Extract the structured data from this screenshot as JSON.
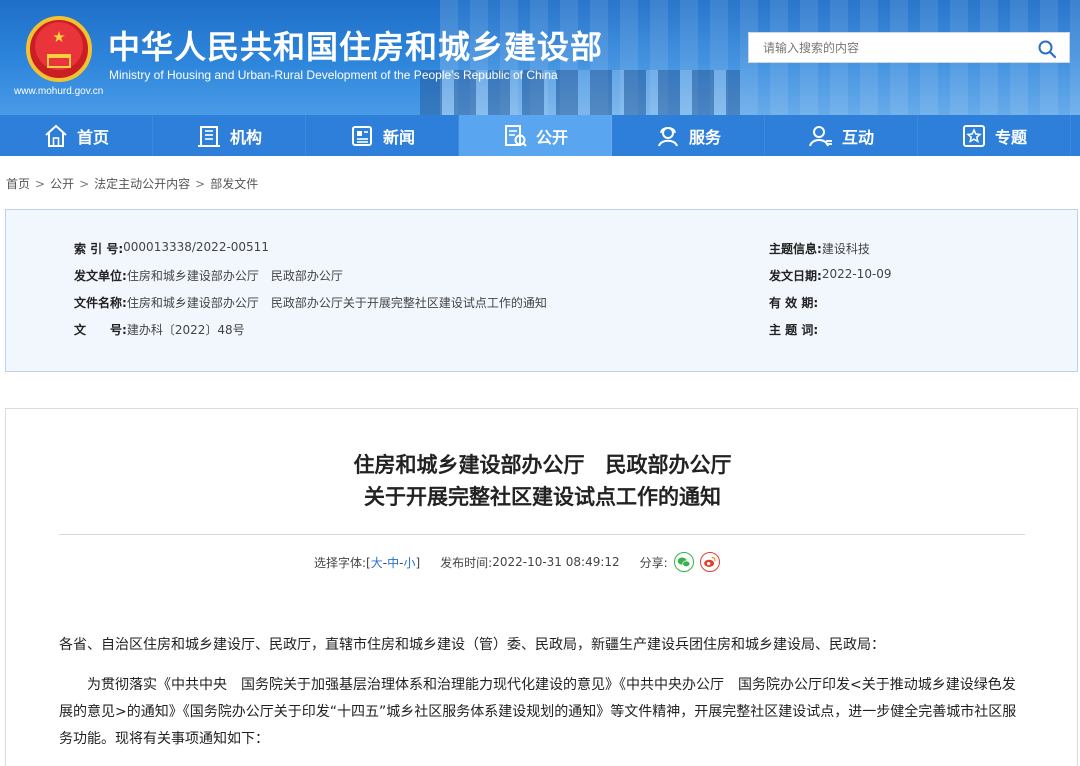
{
  "header": {
    "title_cn": "中华人民共和国住房和城乡建设部",
    "title_en": "Ministry of Housing and Urban-Rural Development of the People’s Republic of China",
    "site_url": "www.mohurd.gov.cn",
    "search_placeholder": "请输入搜索的内容",
    "search_icon": "search-icon"
  },
  "nav": {
    "items": [
      {
        "label": "首页",
        "icon": "home-icon"
      },
      {
        "label": "机构",
        "icon": "building-icon"
      },
      {
        "label": "新闻",
        "icon": "newspaper-icon"
      },
      {
        "label": "公开",
        "icon": "document-icon"
      },
      {
        "label": "服务",
        "icon": "service-icon"
      },
      {
        "label": "互动",
        "icon": "user-icon"
      },
      {
        "label": "专题",
        "icon": "star-icon"
      }
    ],
    "active_index": 3
  },
  "breadcrumb": [
    "首页",
    "公开",
    "法定主动公开内容",
    "部发文件"
  ],
  "info": {
    "index_label": "索 引 号:",
    "index_value": "000013338/2022-00511",
    "unit_label": "发文单位:",
    "unit_value": "住房和城乡建设部办公厅　民政部办公厅",
    "docname_label": "文件名称:",
    "docname_value": "住房和城乡建设部办公厅　民政部办公厅关于开展完整社区建设试点工作的通知",
    "docno_label": "文　　号:",
    "docno_value": "建办科〔2022〕48号",
    "subject_label": "主题信息:",
    "subject_value": "建设科技",
    "date_label": "发文日期:",
    "date_value": "2022-10-09",
    "validity_label": "有 效 期:",
    "validity_value": "",
    "keywords_label": "主 题 词:",
    "keywords_value": ""
  },
  "article": {
    "title_line1": "住房和城乡建设部办公厅　民政部办公厅",
    "title_line2": "关于开展完整社区建设试点工作的通知",
    "font_label": "选择字体:[",
    "font_large": "大",
    "font_medium": "中",
    "font_small": "小",
    "font_close": "]",
    "publish_label": "发布时间:",
    "publish_time": "2022-10-31 08:49:12",
    "share_label": "分享:",
    "para1": "各省、自治区住房和城乡建设厅、民政厅，直辖市住房和城乡建设（管）委、民政局，新疆生产建设兵团住房和城乡建设局、民政局：",
    "para2": "为贯彻落实《中共中央　国务院关于加强基层治理体系和治理能力现代化建设的意见》《中共中央办公厅　国务院办公厅印发<关于推动城乡建设绿色发展的意见>的通知》《国务院办公厅关于印发“十四五”城乡社区服务体系建设规划的通知》等文件精神，开展完整社区建设试点，进一步健全完善城市社区服务功能。现将有关事项通知如下："
  },
  "colors": {
    "header_blue": "#2e86dc",
    "nav_blue": "#2d7fd9",
    "nav_active": "#5aa5ef",
    "link_blue": "#2a6fd1",
    "wechat_green": "#36b24a",
    "weibo_red": "#e0402f"
  }
}
